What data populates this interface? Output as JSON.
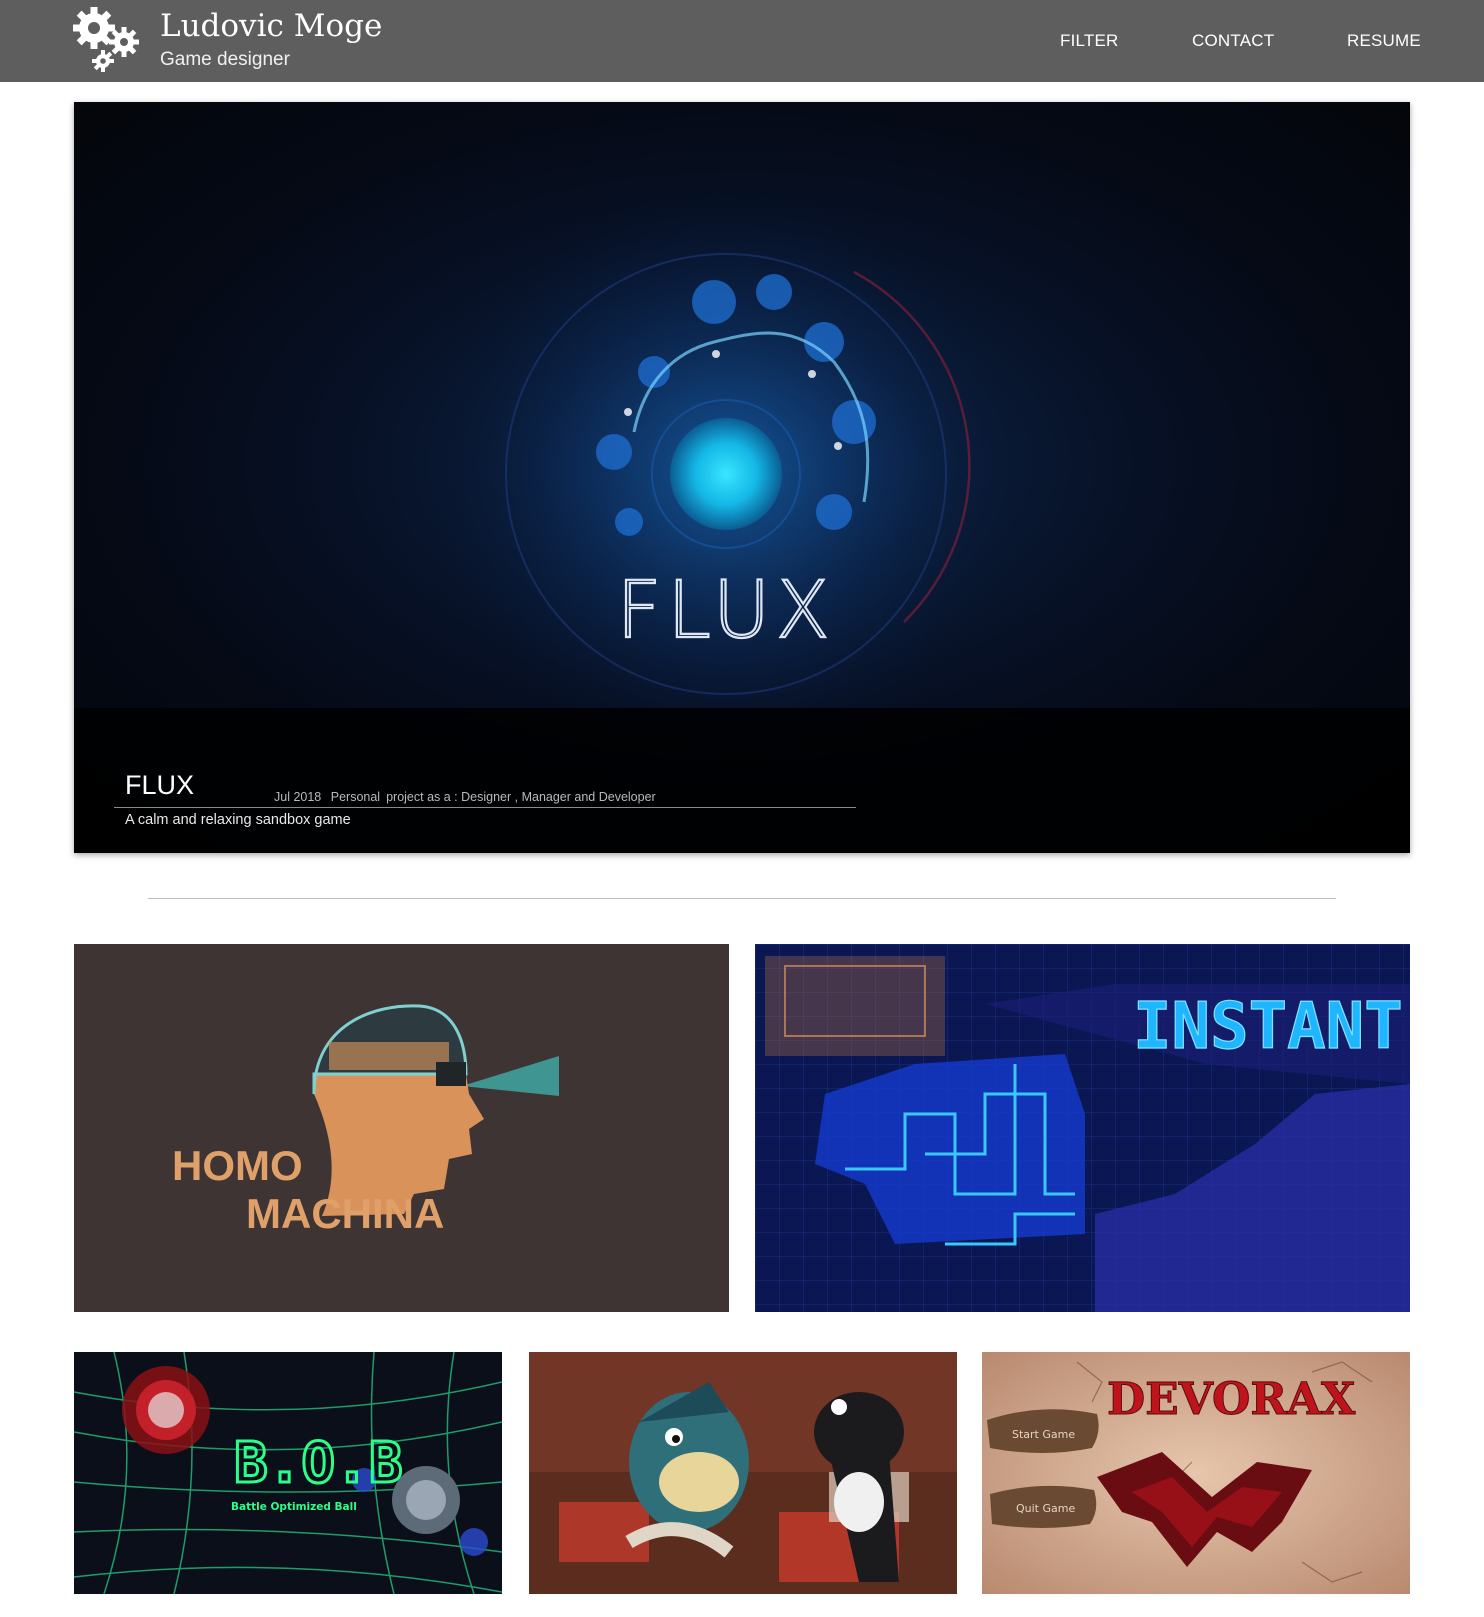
{
  "header": {
    "title": "Ludovic Moge",
    "subtitle": "Game designer",
    "logo_icon": "gears-icon",
    "nav": [
      {
        "label": "FILTER"
      },
      {
        "label": "CONTACT"
      },
      {
        "label": "RESUME"
      }
    ],
    "background_color": "#5e5e5e"
  },
  "featured": {
    "image_text": "FLUX",
    "title": "FLUX",
    "date": "Jul 2018",
    "project_type": "Personal",
    "role": "project as a : Designer , Manager and Developer",
    "description": "A calm and relaxing sandbox game"
  },
  "projects": [
    {
      "logo_text_line1": "HOMO",
      "logo_text_line2": "MACHINA"
    },
    {
      "logo_text": "INSTANT"
    },
    {
      "logo_text": "B.O.B",
      "tagline": "Battle Optimized Ball"
    },
    {
      "logo_text": ""
    },
    {
      "logo_text": "DEVORAX",
      "menu_start": "Start Game",
      "menu_quit": "Quit Game"
    }
  ]
}
